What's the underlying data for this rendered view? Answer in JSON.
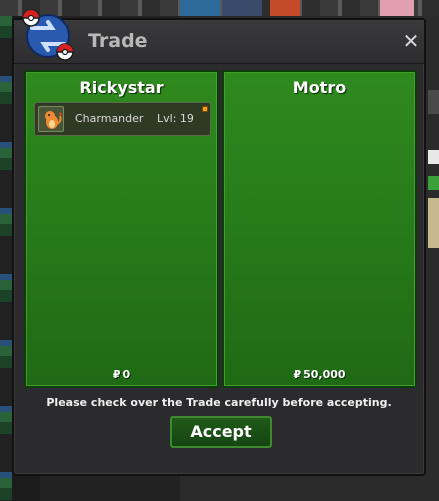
{
  "window": {
    "title": "Trade",
    "close_glyph": "✕"
  },
  "left_panel": {
    "player_name": "Rickystar",
    "money_symbol": "₽",
    "money": "0",
    "pokemon": [
      {
        "name": "Charmander",
        "level": "Lvl: 19",
        "icon": "charmander-icon"
      }
    ]
  },
  "right_panel": {
    "player_name": "Motro",
    "money_symbol": "₽",
    "money": "50,000",
    "pokemon": []
  },
  "notice": "Please check over the Trade carefully before accepting.",
  "accept_label": "Accept",
  "colors": {
    "panel_green": "#2f8a1e",
    "window_bg": "#2b2b2d",
    "accept_bg": "#1f5a18"
  }
}
